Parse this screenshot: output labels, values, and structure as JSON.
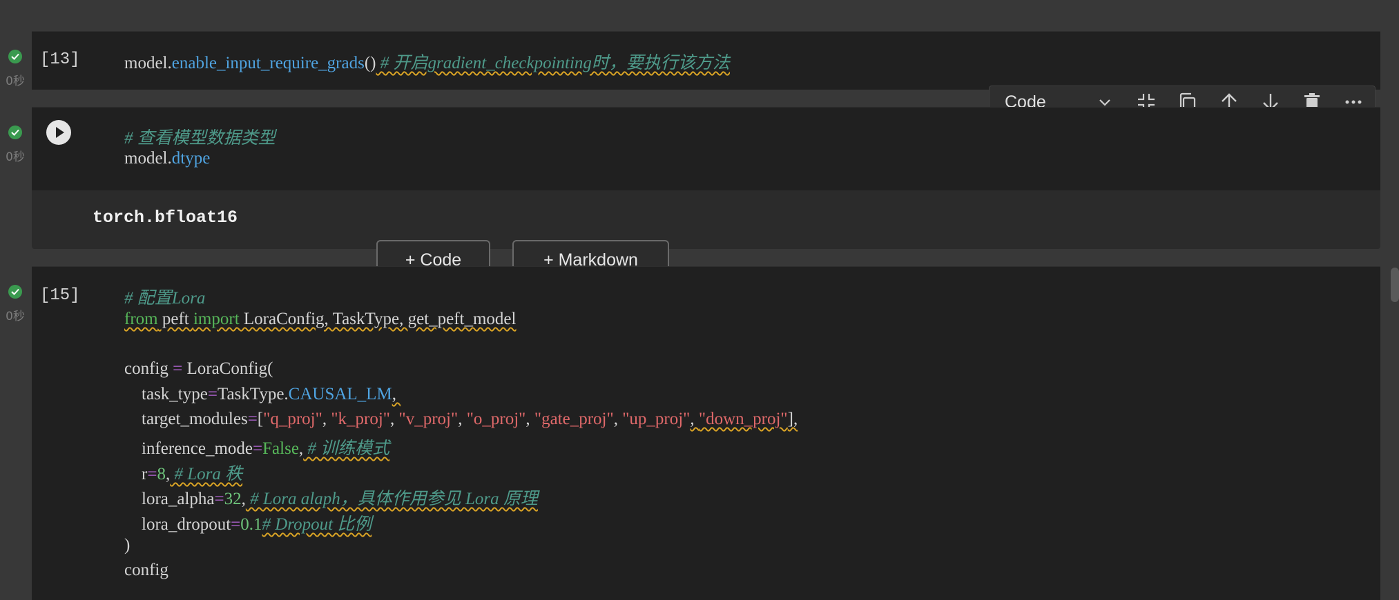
{
  "cells": [
    {
      "exec_count": "[13]",
      "duration": "0秒",
      "code": {
        "obj": "model.",
        "method": "enable_input_require_grads",
        "paren": "()",
        "comment": " # 开启gradient_checkpointing时，要执行该方法"
      }
    },
    {
      "duration": "0秒",
      "comment": "# 查看模型数据类型",
      "obj": "model.",
      "attr": "dtype",
      "output": "torch.bfloat16"
    },
    {
      "exec_count": "[15]",
      "duration": "0秒",
      "lines": {
        "l1_comment": "# 配置Lora",
        "l2_from": "from",
        "l2_mod": " peft ",
        "l2_import": "import",
        "l2_rest": " LoraConfig, TaskType, get_peft_model",
        "l4_config": "config ",
        "l4_eq": "=",
        "l4_rest": " LoraConfig(",
        "l5_key": "    task_type",
        "l5_eq": "=",
        "l5_obj": "TaskType.",
        "l5_attr": "CAUSAL_LM",
        "l5_end": ", ",
        "l6_key": "    target_modules",
        "l6_eq": "=",
        "l6_open": "[",
        "l6_s1": "\"q_proj\"",
        "l6_s2": "\"k_proj\"",
        "l6_s3": "\"v_proj\"",
        "l6_s4": "\"o_proj\"",
        "l6_s5": "\"gate_proj\"",
        "l6_s6": "\"up_proj\"",
        "l6_s7": "\"down_proj\"",
        "l6_close": "],",
        "sep": ", ",
        "l7_key": "    inference_mode",
        "l7_eq": "=",
        "l7_val": "False",
        "l7_comma": ",",
        "l7_comment": " # 训练模式",
        "l8_key": "    r",
        "l8_eq": "=",
        "l8_val": "8",
        "l8_comma": ",",
        "l8_comment": " # Lora 秩",
        "l9_key": "    lora_alpha",
        "l9_eq": "=",
        "l9_val": "32",
        "l9_comma": ",",
        "l9_comment": " # Lora alaph，具体作用参见 Lora 原理",
        "l10_key": "    lora_dropout",
        "l10_eq": "=",
        "l10_val": "0.1",
        "l10_comment": "# Dropout 比例",
        "l11": ")",
        "l12": "config"
      }
    }
  ],
  "toolbar": {
    "cell_type": "Code",
    "icons": [
      "chevron-down-icon",
      "collapse-icon",
      "copy-icon",
      "arrow-up-icon",
      "arrow-down-icon",
      "delete-icon",
      "more-icon"
    ]
  },
  "add_buttons": {
    "code": "+ Code",
    "markdown": "+ Markdown"
  },
  "colors": {
    "background": "#383838",
    "cell": "#202020",
    "success": "#3a9a4f",
    "comment": "#4e9a8a",
    "function": "#4fa3e0",
    "keyword": "#57b85a",
    "string": "#e0696a",
    "operator": "#b766d9"
  }
}
